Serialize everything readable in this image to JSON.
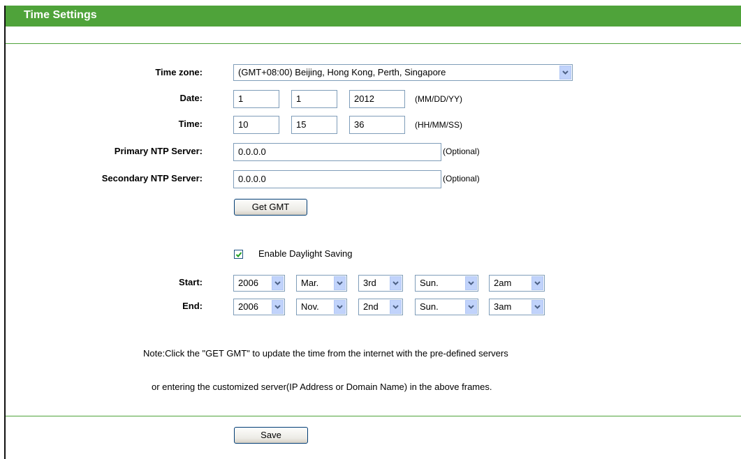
{
  "header": {
    "title": "Time Settings"
  },
  "form": {
    "timezone": {
      "label": "Time zone:",
      "value": "(GMT+08:00) Beijing, Hong Kong, Perth, Singapore"
    },
    "date": {
      "label": "Date:",
      "month": "1",
      "day": "1",
      "year": "2012",
      "format": "(MM/DD/YY)"
    },
    "time": {
      "label": "Time:",
      "hour": "10",
      "minute": "15",
      "second": "36",
      "format": "(HH/MM/SS)"
    },
    "primary_ntp": {
      "label": "Primary NTP Server:",
      "value": "0.0.0.0",
      "hint": "(Optional)"
    },
    "secondary_ntp": {
      "label": "Secondary NTP Server:",
      "value": "0.0.0.0",
      "hint": "(Optional)"
    },
    "get_gmt_label": "Get GMT",
    "daylight": {
      "label": "Enable Daylight Saving",
      "checked": true
    },
    "start": {
      "label": "Start:",
      "year": "2006",
      "month": "Mar.",
      "week": "3rd",
      "day": "Sun.",
      "hour": "2am"
    },
    "end": {
      "label": "End:",
      "year": "2006",
      "month": "Nov.",
      "week": "2nd",
      "day": "Sun.",
      "hour": "3am"
    },
    "note_line1": "Note:Click the \"GET GMT\" to update the time from the internet with the pre-defined servers",
    "note_line2": "or entering the customized server(IP Address or Domain Name) in the above frames.",
    "save_label": "Save"
  },
  "colors": {
    "header_bg": "#4fa33a",
    "select_arrow": "#c1d3fb",
    "check": "#21a121"
  },
  "icons": {
    "dropdown": "chevron-down-icon",
    "checkbox": "checkmark-icon"
  }
}
